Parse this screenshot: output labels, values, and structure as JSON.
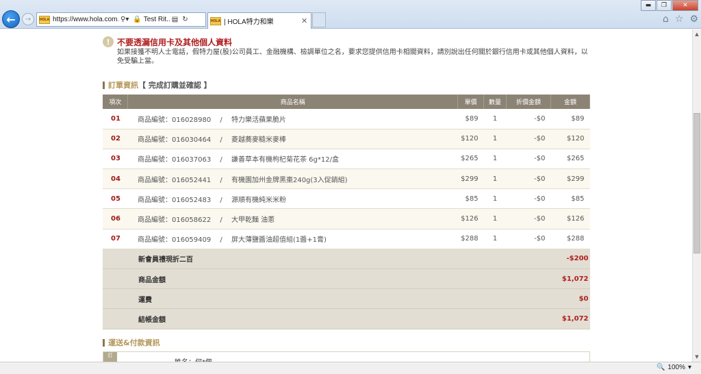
{
  "browser": {
    "url": "https://www.hola.com.tw/ca",
    "cert_label": "Test Rit...",
    "tab_title": "| HOLA特力和樂",
    "zoom": "100%"
  },
  "notice": {
    "title": "不要透漏信用卡及其他個人資料",
    "body": "如果接獲不明人士電話，假特力屋(股)公司員工、金融機構、檢調單位之名，要求您提供信用卡相關資料，請別說出任何關於銀行信用卡或其他個人資料，以免受騙上當。"
  },
  "order_section": {
    "title": "訂單資訊",
    "subtitle": "【 完成訂購並確認 】"
  },
  "table": {
    "headers": [
      "項次",
      "商品名稱",
      "單價",
      "數量",
      "折價金額",
      "金額"
    ],
    "rows": [
      {
        "no": "01",
        "product": "商品編號：016028980 　/　 特力樂活蘋果脆片",
        "price": "$89",
        "qty": "1",
        "discount": "-$0",
        "amount": "$89"
      },
      {
        "no": "02",
        "product": "商品編號：016030464 　/　 菱越蕎麥糙米麥棒",
        "price": "$120",
        "qty": "1",
        "discount": "-$0",
        "amount": "$120"
      },
      {
        "no": "03",
        "product": "商品編號：016037063 　/　 謙善草本有機枸杞菊花茶 6g*12/盒",
        "price": "$265",
        "qty": "1",
        "discount": "-$0",
        "amount": "$265"
      },
      {
        "no": "04",
        "product": "商品編號：016052441 　/　 有機園加州金牌黑棗240g(3入促銷組)",
        "price": "$299",
        "qty": "1",
        "discount": "-$0",
        "amount": "$299"
      },
      {
        "no": "05",
        "product": "商品編號：016052483 　/　 源順有機純米米粉",
        "price": "$85",
        "qty": "1",
        "discount": "-$0",
        "amount": "$85"
      },
      {
        "no": "06",
        "product": "商品編號：016058622 　/　 大甲乾麵 油蔥",
        "price": "$126",
        "qty": "1",
        "discount": "-$0",
        "amount": "$126"
      },
      {
        "no": "07",
        "product": "商品編號：016059409 　/　 屏大薄鹽醬油超值組(1醬+1膏)",
        "price": "$288",
        "qty": "1",
        "discount": "-$0",
        "amount": "$288"
      }
    ],
    "summary": [
      {
        "label": "新會員禮現折二百",
        "value": "-$200"
      },
      {
        "label": "商品金額",
        "value": "$1,072"
      },
      {
        "label": "運費",
        "value": "$0"
      },
      {
        "label": "結帳金額",
        "value": "$1,072"
      }
    ]
  },
  "shipping_section": {
    "title": "運送&付款資訊",
    "side_label": "訂",
    "name_line": "姓名：何*佩"
  }
}
